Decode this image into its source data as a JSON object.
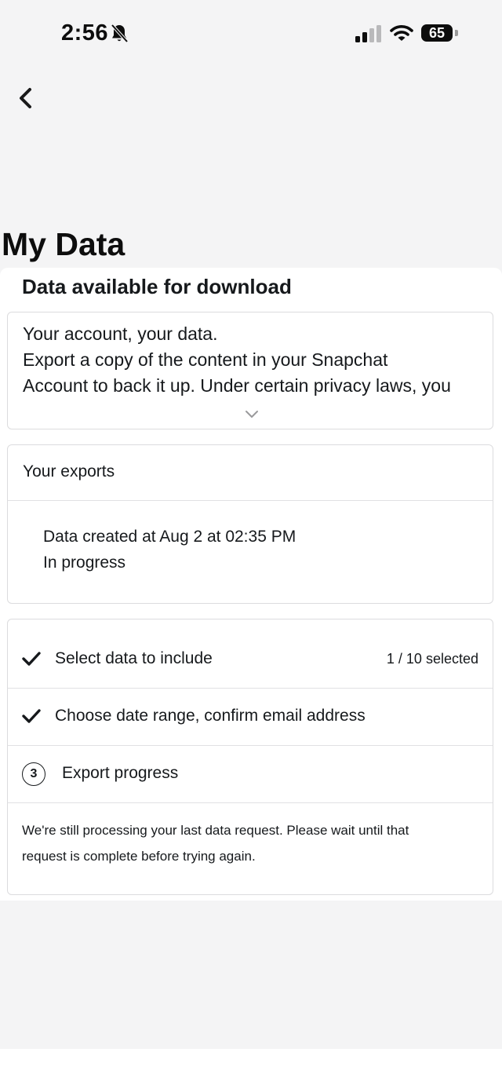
{
  "status_bar": {
    "time": "2:56",
    "battery": "65",
    "icons": [
      "bell-slash-icon",
      "cellular-signal-icon",
      "wifi-icon",
      "battery-icon"
    ]
  },
  "navigation": {
    "back_icon": "chevron-left-icon"
  },
  "page": {
    "title": "My Data"
  },
  "download_section": {
    "heading": "Data available for download",
    "intro_lines": [
      "Your account, your data.",
      "Export a copy of the content in your Snapchat",
      "Account to back it up. Under certain privacy laws, you"
    ],
    "expand_icon": "chevron-down-icon"
  },
  "exports": {
    "title": "Your exports",
    "items": [
      {
        "created": "Data created at Aug 2 at 02:35 PM",
        "status": "In progress"
      }
    ]
  },
  "steps": [
    {
      "state": "done",
      "label": "Select data to include",
      "count": "1 / 10 selected"
    },
    {
      "state": "done",
      "label": "Choose date range, confirm email address"
    },
    {
      "state": "current",
      "number": "3",
      "label": "Export progress"
    }
  ],
  "notice_lines": [
    "We're still processing your last data request. Please wait until that",
    "request is complete before trying again."
  ],
  "colors": {
    "background": "#f4f4f5",
    "surface": "#ffffff",
    "text": "#16191c",
    "border": "#dcdcde"
  }
}
